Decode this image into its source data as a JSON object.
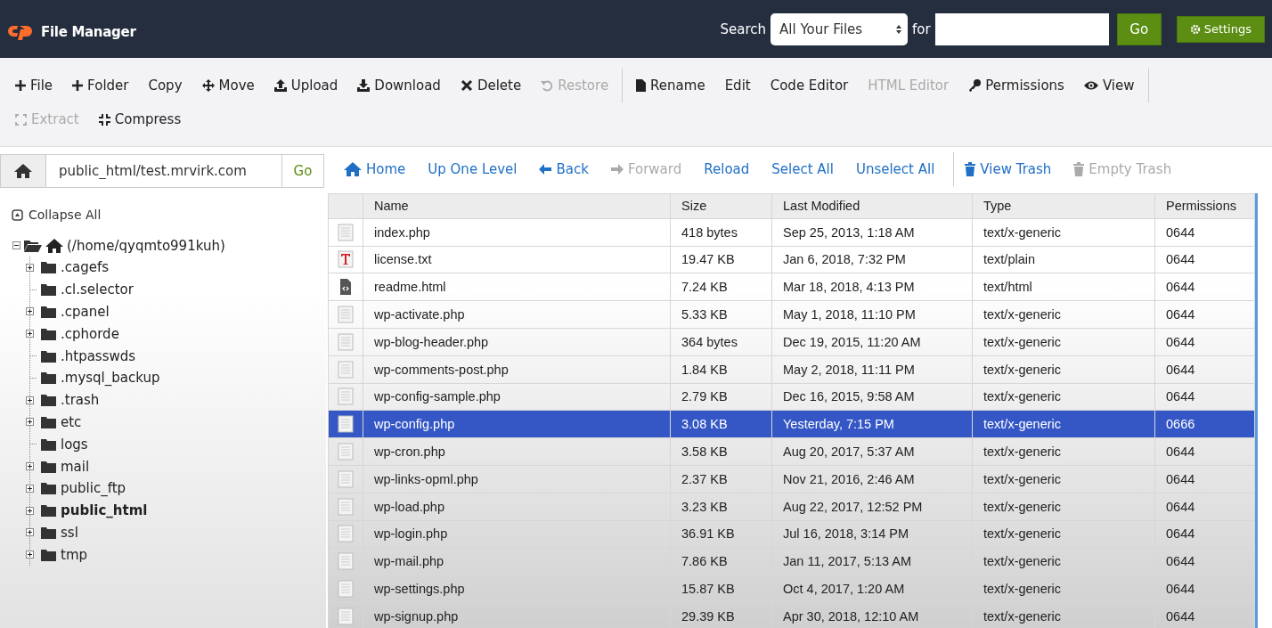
{
  "header": {
    "title": "File Manager",
    "search_label": "Search",
    "search_scope": "All Your Files",
    "for_label": "for",
    "search_button": "Go",
    "settings_button": "Settings"
  },
  "toolbar": [
    {
      "label": "File",
      "disabled": false
    },
    {
      "label": "Folder",
      "disabled": false
    },
    {
      "label": "Copy",
      "disabled": false
    },
    {
      "label": "Move",
      "disabled": false
    },
    {
      "label": "Upload",
      "disabled": false
    },
    {
      "label": "Download",
      "disabled": false
    },
    {
      "label": "Delete",
      "disabled": false
    },
    {
      "label": "Restore",
      "disabled": true
    },
    {
      "label": "Rename",
      "disabled": false
    },
    {
      "label": "Edit",
      "disabled": false
    },
    {
      "label": "Code Editor",
      "disabled": false
    },
    {
      "label": "HTML Editor",
      "disabled": true
    },
    {
      "label": "Permissions",
      "disabled": false
    },
    {
      "label": "View",
      "disabled": false
    },
    {
      "label": "Extract",
      "disabled": true
    },
    {
      "label": "Compress",
      "disabled": false
    }
  ],
  "path_bar": {
    "value": "public_html/test.mrvirk.com",
    "button": "Go"
  },
  "nav": [
    {
      "label": "Home",
      "disabled": false
    },
    {
      "label": "Up One Level",
      "disabled": false
    },
    {
      "label": "Back",
      "disabled": false
    },
    {
      "label": "Forward",
      "disabled": true
    },
    {
      "label": "Reload",
      "disabled": false
    },
    {
      "label": "Select All",
      "disabled": false
    },
    {
      "label": "Unselect All",
      "disabled": false
    },
    {
      "label": "View Trash",
      "disabled": false
    },
    {
      "label": "Empty Trash",
      "disabled": true
    }
  ],
  "sidebar": {
    "collapse_all": "Collapse All",
    "tree": {
      "label": "(/home/qyqmto991kuh)",
      "expanded": true,
      "children": [
        {
          "label": ".cagefs",
          "expandable": true,
          "selected": false
        },
        {
          "label": ".cl.selector",
          "expandable": false,
          "selected": false
        },
        {
          "label": ".cpanel",
          "expandable": true,
          "selected": false
        },
        {
          "label": ".cphorde",
          "expandable": true,
          "selected": false
        },
        {
          "label": ".htpasswds",
          "expandable": false,
          "selected": false
        },
        {
          "label": ".mysql_backup",
          "expandable": false,
          "selected": false
        },
        {
          "label": ".trash",
          "expandable": true,
          "selected": false
        },
        {
          "label": "etc",
          "expandable": true,
          "selected": false
        },
        {
          "label": "logs",
          "expandable": false,
          "selected": false
        },
        {
          "label": "mail",
          "expandable": true,
          "selected": false
        },
        {
          "label": "public_ftp",
          "expandable": true,
          "selected": false
        },
        {
          "label": "public_html",
          "expandable": true,
          "selected": true
        },
        {
          "label": "ssl",
          "expandable": true,
          "selected": false
        },
        {
          "label": "tmp",
          "expandable": true,
          "selected": false
        }
      ]
    }
  },
  "table": {
    "columns": [
      "Name",
      "Size",
      "Last Modified",
      "Type",
      "Permissions"
    ],
    "rows": [
      {
        "kind": "generic",
        "name": "index.php",
        "size": "418 bytes",
        "modified": "Sep 25, 2013, 1:18 AM",
        "type": "text/x-generic",
        "permissions": "0644",
        "selected": false
      },
      {
        "kind": "text",
        "name": "license.txt",
        "size": "19.47 KB",
        "modified": "Jan 6, 2018, 7:32 PM",
        "type": "text/plain",
        "permissions": "0644",
        "selected": false
      },
      {
        "kind": "html",
        "name": "readme.html",
        "size": "7.24 KB",
        "modified": "Mar 18, 2018, 4:13 PM",
        "type": "text/html",
        "permissions": "0644",
        "selected": false
      },
      {
        "kind": "generic",
        "name": "wp-activate.php",
        "size": "5.33 KB",
        "modified": "May 1, 2018, 11:10 PM",
        "type": "text/x-generic",
        "permissions": "0644",
        "selected": false
      },
      {
        "kind": "generic",
        "name": "wp-blog-header.php",
        "size": "364 bytes",
        "modified": "Dec 19, 2015, 11:20 AM",
        "type": "text/x-generic",
        "permissions": "0644",
        "selected": false
      },
      {
        "kind": "generic",
        "name": "wp-comments-post.php",
        "size": "1.84 KB",
        "modified": "May 2, 2018, 11:11 PM",
        "type": "text/x-generic",
        "permissions": "0644",
        "selected": false
      },
      {
        "kind": "generic",
        "name": "wp-config-sample.php",
        "size": "2.79 KB",
        "modified": "Dec 16, 2015, 9:58 AM",
        "type": "text/x-generic",
        "permissions": "0644",
        "selected": false
      },
      {
        "kind": "generic",
        "name": "wp-config.php",
        "size": "3.08 KB",
        "modified": "Yesterday, 7:15 PM",
        "type": "text/x-generic",
        "permissions": "0666",
        "selected": true
      },
      {
        "kind": "generic",
        "name": "wp-cron.php",
        "size": "3.58 KB",
        "modified": "Aug 20, 2017, 5:37 AM",
        "type": "text/x-generic",
        "permissions": "0644",
        "selected": false
      },
      {
        "kind": "generic",
        "name": "wp-links-opml.php",
        "size": "2.37 KB",
        "modified": "Nov 21, 2016, 2:46 AM",
        "type": "text/x-generic",
        "permissions": "0644",
        "selected": false
      },
      {
        "kind": "generic",
        "name": "wp-load.php",
        "size": "3.23 KB",
        "modified": "Aug 22, 2017, 12:52 PM",
        "type": "text/x-generic",
        "permissions": "0644",
        "selected": false
      },
      {
        "kind": "generic",
        "name": "wp-login.php",
        "size": "36.91 KB",
        "modified": "Jul 16, 2018, 3:14 PM",
        "type": "text/x-generic",
        "permissions": "0644",
        "selected": false
      },
      {
        "kind": "generic",
        "name": "wp-mail.php",
        "size": "7.86 KB",
        "modified": "Jan 11, 2017, 5:13 AM",
        "type": "text/x-generic",
        "permissions": "0644",
        "selected": false
      },
      {
        "kind": "generic",
        "name": "wp-settings.php",
        "size": "15.87 KB",
        "modified": "Oct 4, 2017, 1:20 AM",
        "type": "text/x-generic",
        "permissions": "0644",
        "selected": false
      },
      {
        "kind": "generic",
        "name": "wp-signup.php",
        "size": "29.39 KB",
        "modified": "Apr 30, 2018, 12:10 AM",
        "type": "text/x-generic",
        "permissions": "0644",
        "selected": false
      }
    ]
  }
}
